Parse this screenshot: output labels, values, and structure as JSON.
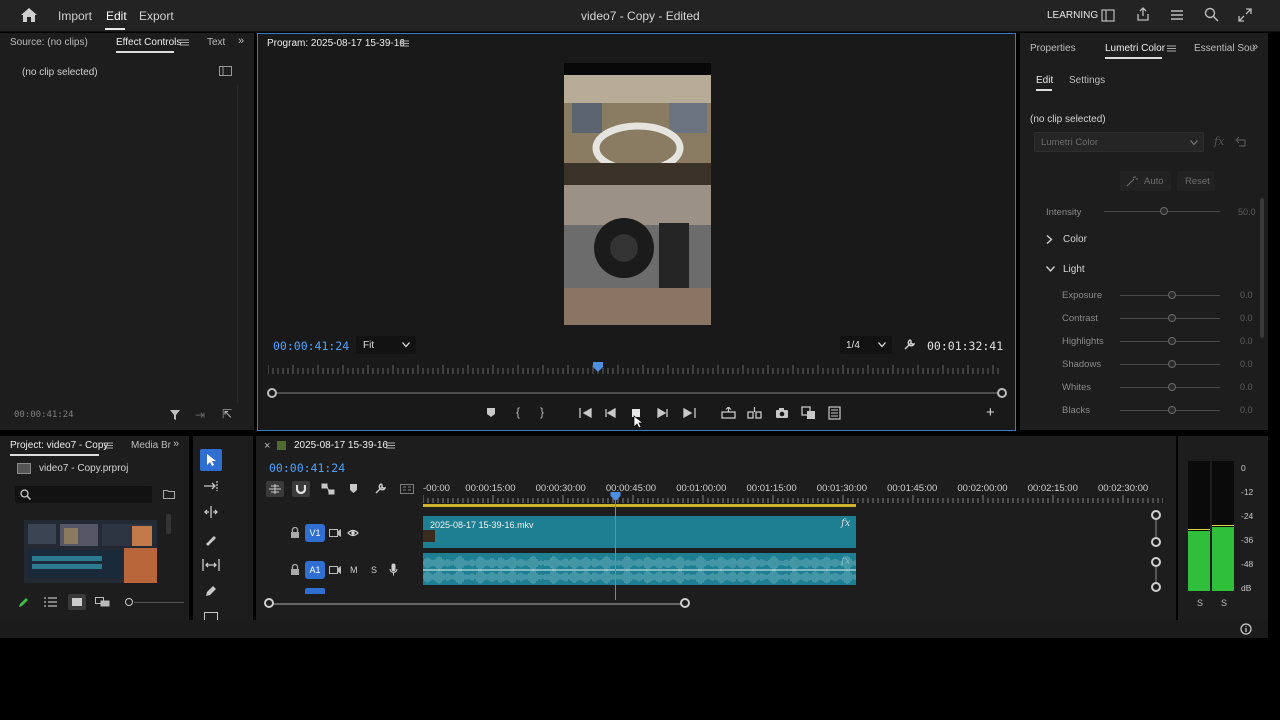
{
  "topbar": {
    "menu": {
      "import": "Import",
      "edit": "Edit",
      "export": "Export"
    },
    "title": "video7 - Copy - Edited",
    "workspace": "LEARNING"
  },
  "source_panel": {
    "tabs": {
      "source": "Source: (no clips)",
      "effect_controls": "Effect Controls",
      "text": "Text"
    },
    "no_clip": "(no clip selected)",
    "timecode": "00:00:41:24"
  },
  "program_monitor": {
    "title": "Program: 2025-08-17 15-39-16",
    "timecode": "00:00:41:24",
    "fit": "Fit",
    "resolution": "1/4",
    "duration": "00:01:32:41",
    "playhead_fraction": 0.452
  },
  "lumetri": {
    "tabs": {
      "properties": "Properties",
      "lumetri_color": "Lumetri Color",
      "essential": "Essential Sou"
    },
    "subtabs": {
      "edit": "Edit",
      "settings": "Settings"
    },
    "no_clip": "(no clip selected)",
    "effect_select": "Lumetri Color",
    "auto": "Auto",
    "reset": "Reset",
    "intensity": {
      "label": "Intensity",
      "value": "50.0"
    },
    "sections": {
      "color": "Color",
      "light": "Light"
    },
    "light_rows": [
      {
        "label": "Exposure",
        "value": "0.0"
      },
      {
        "label": "Contrast",
        "value": "0.0"
      },
      {
        "label": "Highlights",
        "value": "0.0"
      },
      {
        "label": "Shadows",
        "value": "0.0"
      },
      {
        "label": "Whites",
        "value": "0.0"
      },
      {
        "label": "Blacks",
        "value": "0.0"
      }
    ]
  },
  "project_panel": {
    "tabs": {
      "project": "Project: video7 - Copy",
      "media_browser": "Media Br"
    },
    "filename": "video7 - Copy.prproj"
  },
  "timeline": {
    "sequence_name": "2025-08-17 15-39-16",
    "timecode": "00:00:41:24",
    "ruler": [
      "-00:00",
      "00:00:15:00",
      "00:00:30:00",
      "00:00:45:00",
      "00:01:00:00",
      "00:01:15:00",
      "00:01:30:00",
      "00:01:45:00",
      "00:02:00:00",
      "00:02:15:00",
      "00:02:30:00"
    ],
    "tracks": {
      "v1": {
        "label": "V1"
      },
      "a1": {
        "label": "A1",
        "m": "M",
        "s": "S"
      }
    },
    "clip_name": "2025-08-17 15-39-16.mkv",
    "fx": "fx"
  },
  "audio_meter": {
    "scale": [
      "0",
      "-12",
      "-24",
      "-36",
      "-48",
      "dB"
    ],
    "solo": [
      "S",
      "S"
    ]
  },
  "colors": {
    "accent_blue": "#4aa3ff",
    "clip_teal": "#1f7f92",
    "panel_bg": "#1d1d1d",
    "meter_green": "#2fbf3a"
  }
}
